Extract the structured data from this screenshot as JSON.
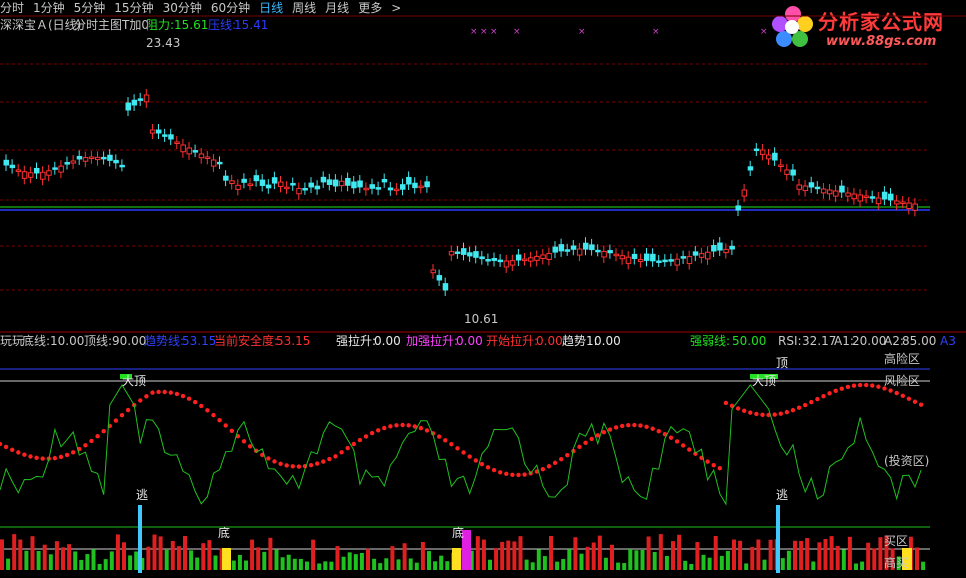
{
  "tabs": [
    {
      "label": "分时",
      "active": false
    },
    {
      "label": "1分钟",
      "active": false
    },
    {
      "label": "5分钟",
      "active": false
    },
    {
      "label": "15分钟",
      "active": false
    },
    {
      "label": "30分钟",
      "active": false
    },
    {
      "label": "60分钟",
      "active": false
    },
    {
      "label": "日线",
      "active": true
    },
    {
      "label": "周线",
      "active": false
    },
    {
      "label": "月线",
      "active": false
    },
    {
      "label": "更多",
      "active": false
    }
  ],
  "tab_more_arrow": ">",
  "logo": {
    "title": "分析家公式网",
    "url": "www.88gs.com"
  },
  "main_panel": {
    "title": "深深宝Ａ(日线)",
    "indicator": "分时主图T加0",
    "resistance": {
      "label": "阻力:",
      "value": "15.61"
    },
    "support": {
      "label": "压线:",
      "value": "15.41"
    },
    "high_label": "23.43",
    "low_label": "10.61",
    "colors": {
      "up": "#ff3030",
      "down": "#40e8f0",
      "resistance": "#20e020",
      "support": "#2a3cff"
    }
  },
  "sub_panel": {
    "name": "玩玩",
    "bottom_line": {
      "label": "底线:",
      "value": "10.00"
    },
    "top_line": {
      "label": "顶线:",
      "value": "90.00"
    },
    "trend_line": {
      "label": "趋势线:",
      "value": "53.15"
    },
    "safety": {
      "label": "当前安全度:",
      "value": "53.15"
    },
    "pull_up": {
      "label": "强拉升:",
      "value": "0.00"
    },
    "add_pull_up": {
      "label": "加强拉升:",
      "value": "0.00"
    },
    "start_pull_up": {
      "label": "开始拉升:",
      "value": "0.00"
    },
    "trend1": {
      "label": "趋势1:",
      "value": "0.00"
    },
    "strength": {
      "label": "强弱线:",
      "value": "50.00"
    },
    "rsi": {
      "label": "RSI:",
      "value": "32.17"
    },
    "a1": {
      "label": "A1:",
      "value": "20.00"
    },
    "a2": {
      "label": "A2:",
      "value": "85.00"
    },
    "a3": {
      "label": "A3"
    },
    "zones": {
      "high_risk": "高险区",
      "risk": "风险区",
      "invest": "(投资区)",
      "buy": "买区",
      "high_buy": "高买"
    },
    "tags": {
      "big_top": "大顶",
      "top": "顶",
      "escape": "逃",
      "bottom": "底"
    }
  }
}
